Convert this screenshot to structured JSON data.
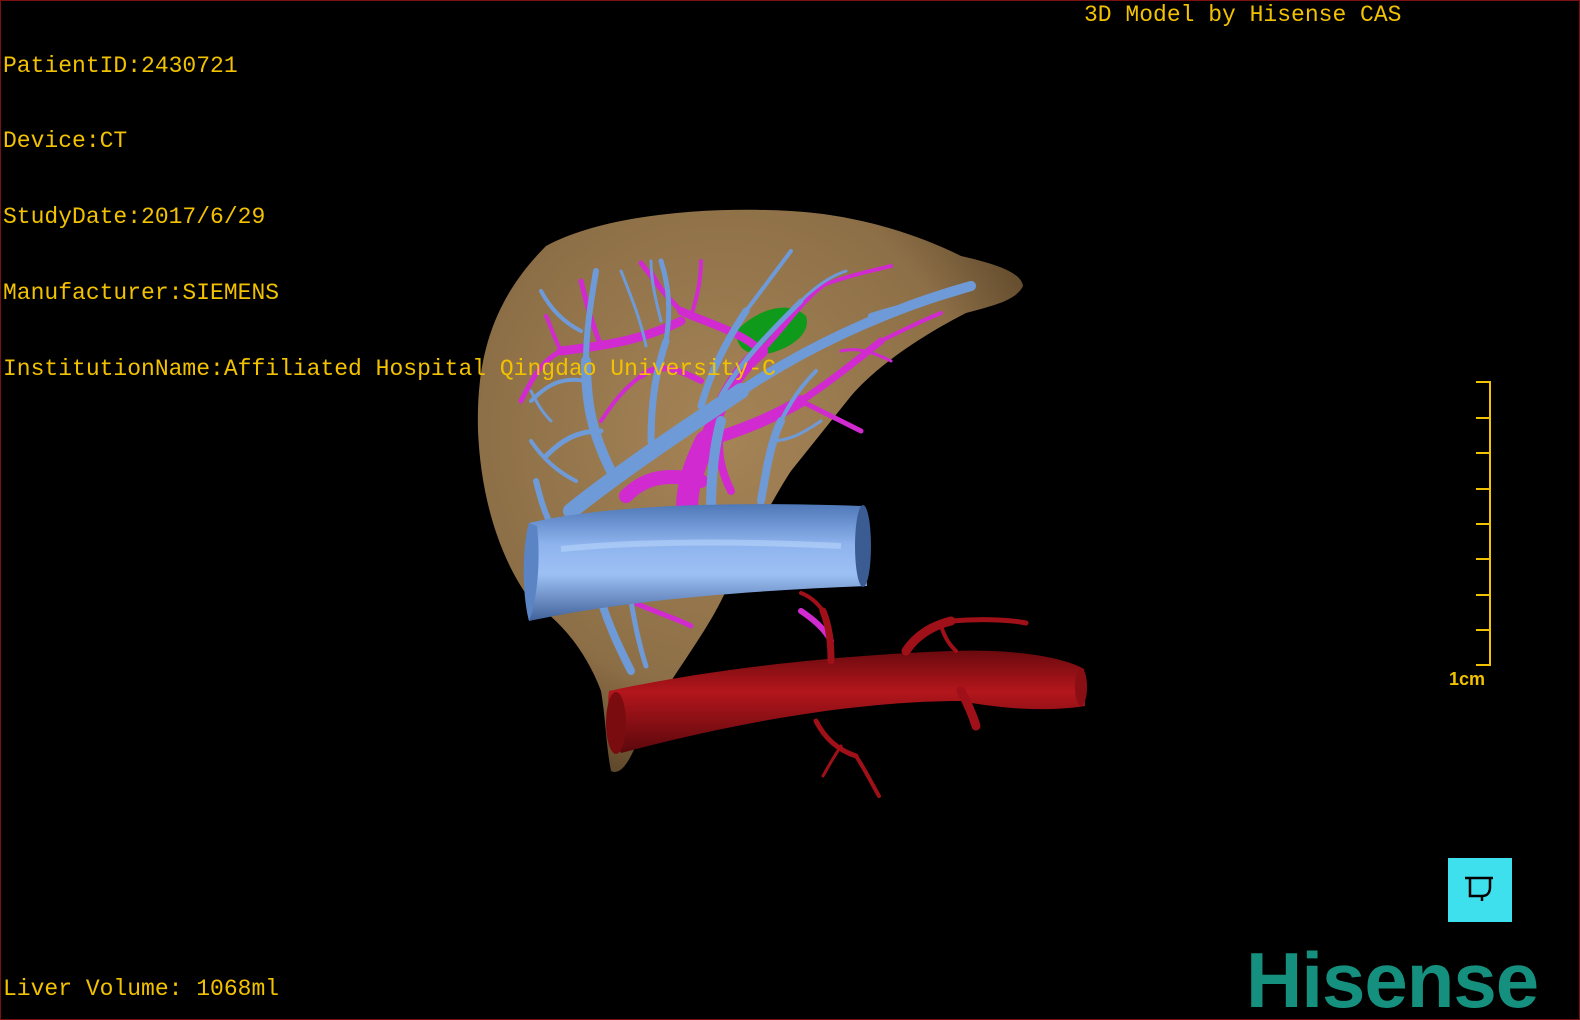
{
  "overlay": {
    "patient_id": "PatientID:2430721",
    "device": "Device:CT",
    "study_date": "StudyDate:2017/6/29",
    "manufacturer": "Manufacturer:SIEMENS",
    "institution": "InstitutionName:Affiliated Hospital Qingdao University-C",
    "model_credit": "3D Model by Hisense CAS",
    "liver_volume": "Liver Volume: 1068ml"
  },
  "scale_bar": {
    "label": "1cm"
  },
  "orientation_button": {
    "icon": "posterior-view-icon"
  },
  "logo": {
    "text": "Hisense"
  },
  "colors": {
    "overlay_text": "#f2c200",
    "liver": "#9a7a50",
    "hepatic_vein": "#6f9ad8",
    "portal_vein": "#d02ad0",
    "artery": "#a01018",
    "gallbladder": "#0f9a1c",
    "logo": "#16907e",
    "orientation_button": "#3fe0ee"
  }
}
